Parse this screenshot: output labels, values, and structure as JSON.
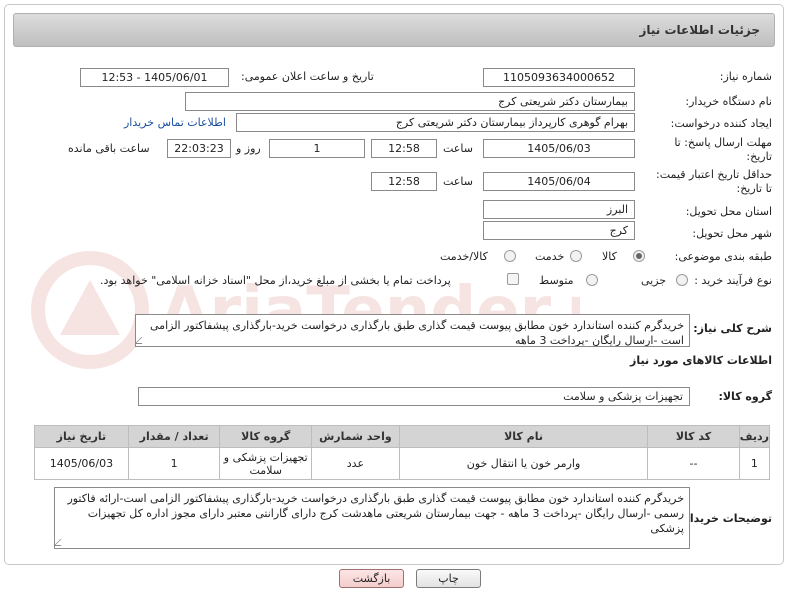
{
  "header": {
    "title": "جزئیات اطلاعات نیاز"
  },
  "fields": {
    "need_number_label": "شماره نیاز:",
    "need_number": "1105093634000652",
    "announce_label": "تاریخ و ساعت اعلان عمومی:",
    "announce_value": "1405/06/01 - 12:53",
    "buyer_org_label": "نام دستگاه خریدار:",
    "buyer_org": "بیمارستان دکتر شریعتی کرج",
    "creator_label": "ایجاد کننده درخواست:",
    "creator": "بهرام گوهری کارپرداز بیمارستان دکتر شریعتی کرج",
    "contact_link": "اطلاعات تماس خریدار",
    "deadline_label_1": "مهلت ارسال پاسخ: تا",
    "deadline_label_2": "تاریخ:",
    "deadline_date": "1405/06/03",
    "time_label": "ساعت",
    "deadline_time": "12:58",
    "day_label": "روز و",
    "days_count": "1",
    "remaining_time": "22:03:23",
    "remaining_label": "ساعت باقی مانده",
    "validity_label_1": "حداقل تاریخ اعتبار قیمت:",
    "validity_label_2": "تا تاریخ:",
    "validity_date": "1405/06/04",
    "validity_time": "12:58",
    "province_label": "استان محل تحویل:",
    "province": "البرز",
    "city_label": "شهر محل تحویل:",
    "city": "کرج",
    "category_label": "طبقه بندی موضوعی:",
    "category_options": [
      "کالا",
      "خدمت",
      "کالا/خدمت"
    ],
    "category_selected": "کالا",
    "process_label": "نوع فرآیند خرید :",
    "process_options": [
      "جزیی",
      "متوسط"
    ],
    "payment_note": "پرداخت تمام یا بخشی از مبلغ خرید،از محل \"اسناد خزانه اسلامی\" خواهد بود.",
    "summary_label": "شرح کلی نیاز:",
    "summary_text": "خریدگرم کننده استاندارد خون مطابق پیوست   قیمت گذاری طبق بارگذاری درخواست خرید-بارگذاری پیشفاکتور الزامی است -ارسال رایگان -پرداخت 3 ماهه",
    "goods_info_title": "اطلاعات کالاهای مورد نیاز",
    "goods_group_label": "گروه کالا:",
    "goods_group": "تجهیزات پزشکی و سلامت",
    "buyer_notes_label": "توضیحات خریدار:",
    "buyer_notes": "خریدگرم کننده استاندارد خون  مطابق پیوست   قیمت گذاری طبق بارگذاری درخواست خرید-بارگذاری پیشفاکتور الزامی است-ارائه فاکتور رسمی -ارسال رایگان -پرداخت 3 ماهه - جهت بیمارستان شریعتی ماهدشت کرج دارای گارانتی معتبر دارای مجوز اداره کل تجهیزات پزشکی"
  },
  "table": {
    "headers": [
      "ردیف",
      "کد کالا",
      "نام کالا",
      "واحد شمارش",
      "گروه کالا",
      "تعداد / مقدار",
      "تاریخ نیاز"
    ],
    "rows": [
      [
        "1",
        "--",
        "وارمر خون یا انتقال خون",
        "عدد",
        "تجهیزات پزشکی و سلامت",
        "1",
        "1405/06/03"
      ]
    ]
  },
  "buttons": {
    "print": "چاپ",
    "back": "بازگشت"
  },
  "watermark": {
    "text": "AriaTender.net"
  }
}
